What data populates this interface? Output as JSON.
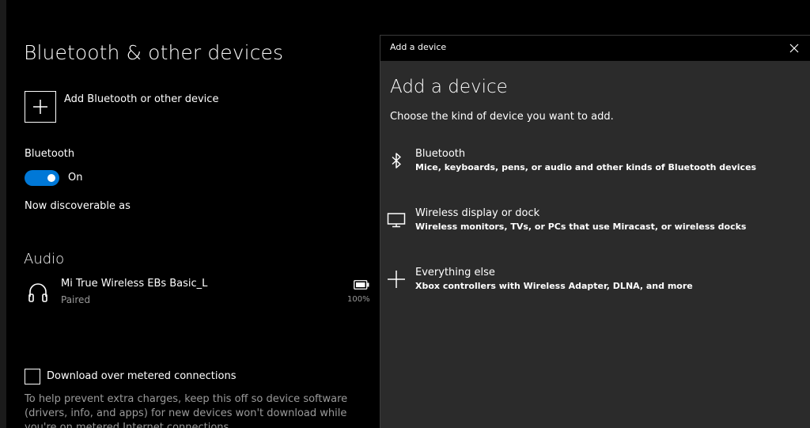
{
  "settings": {
    "page_title": "Bluetooth & other devices",
    "add_device_label": "Add Bluetooth or other device",
    "bluetooth": {
      "heading": "Bluetooth",
      "toggle_state": "On",
      "discoverable_text": "Now discoverable as"
    },
    "audio": {
      "heading": "Audio",
      "device_name": "Mi True Wireless EBs Basic_L",
      "device_status": "Paired",
      "battery_percent": "100%"
    },
    "metered": {
      "label": "Download over metered connections",
      "help_text": "To help prevent extra charges, keep this off so device software (drivers, info, and apps) for new devices won't download while you're on metered Internet connections."
    }
  },
  "dialog": {
    "titlebar": "Add a device",
    "heading": "Add a device",
    "subtitle": "Choose the kind of device you want to add.",
    "options": [
      {
        "icon": "bluetooth-icon",
        "title": "Bluetooth",
        "description": "Mice, keyboards, pens, or audio and other kinds of Bluetooth devices"
      },
      {
        "icon": "monitor-icon",
        "title": "Wireless display or dock",
        "description": "Wireless monitors, TVs, or PCs that use Miracast, or wireless docks"
      },
      {
        "icon": "plus-icon",
        "title": "Everything else",
        "description": "Xbox controllers with Wireless Adapter, DLNA, and more"
      }
    ]
  },
  "colors": {
    "accent": "#0078d7",
    "background": "#000000",
    "dialog_background": "#2b2b2b",
    "secondary_text": "#9a9a9a"
  }
}
